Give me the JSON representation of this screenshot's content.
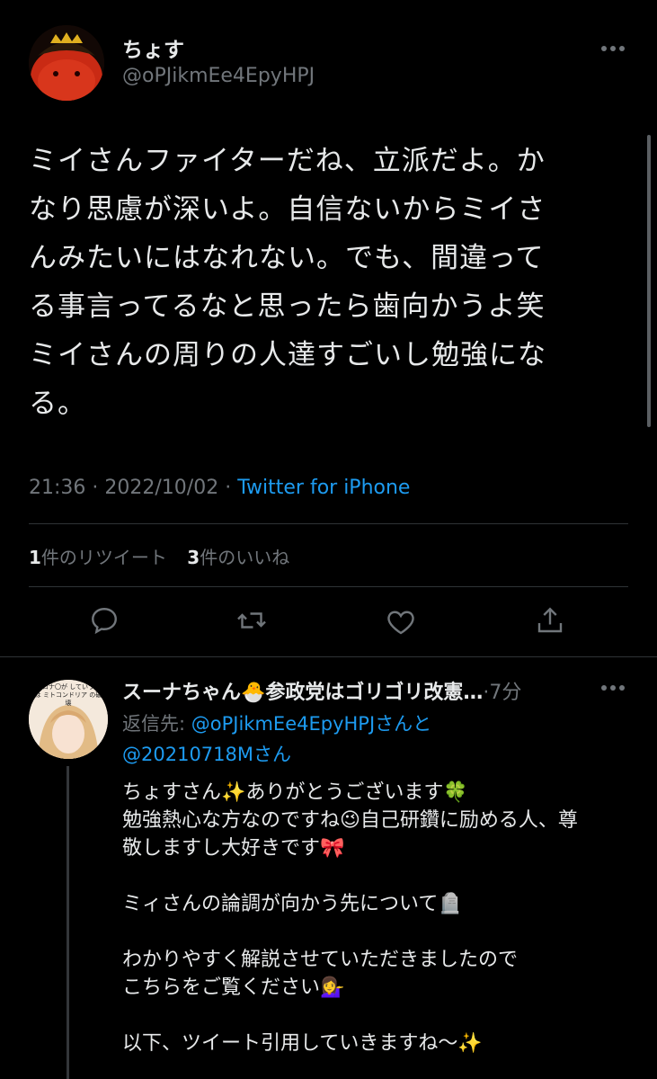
{
  "tweet": {
    "display_name": "ちょす",
    "handle": "@oPJikmEe4EpyHPJ",
    "more_icon": "more-horizontal-icon",
    "text": "ミイさんファイターだね、立派だよ。か\nなり思慮が深いよ。自信ないからミイさ\nんみたいにはなれない。でも、間違って\nる事言ってるなと思ったら歯向かうよ笑\nミイさんの周りの人達すごいし勉強にな\nる。",
    "time": "21:36",
    "date": "2022/10/02",
    "separator": "·",
    "source": "Twitter for iPhone",
    "retweet_count": "1",
    "retweet_label": "件のリツイート",
    "like_count": "3",
    "like_label": "件のいいね"
  },
  "actions": {
    "reply_icon": "reply-icon",
    "retweet_icon": "retweet-icon",
    "like_icon": "heart-icon",
    "share_icon": "share-icon"
  },
  "reply": {
    "display_name": "スーナちゃん🐣参政党はゴリゴリ改憲…",
    "time_sep": "·",
    "time": "7分",
    "reply_prefix": "返信先: ",
    "reply_to_1": "@oPJikmEe4EpyHPJ",
    "reply_and": "さんと",
    "reply_to_2": "@20210718M",
    "reply_san": "さん",
    "avatar_caption": "コロナ〇が していうのは ミトコンドリア の破壊",
    "text": "ちょすさん✨ありがとうございます🍀\n勉強熱心な方なのですね😉自己研鑽に励める人、尊\n敬しますし大好きです🎀\n\nミィさんの論調が向かう先について🪦\n\nわかりやすく解説させていただきましたので\nこちらをご覧ください💁‍♀️\n\n以下、ツイート引用していきますね〜✨"
  },
  "colors": {
    "background": "#000000",
    "text": "#e7e9ea",
    "muted": "#71767b",
    "link": "#1d9bf0",
    "divider": "#2f3336"
  }
}
